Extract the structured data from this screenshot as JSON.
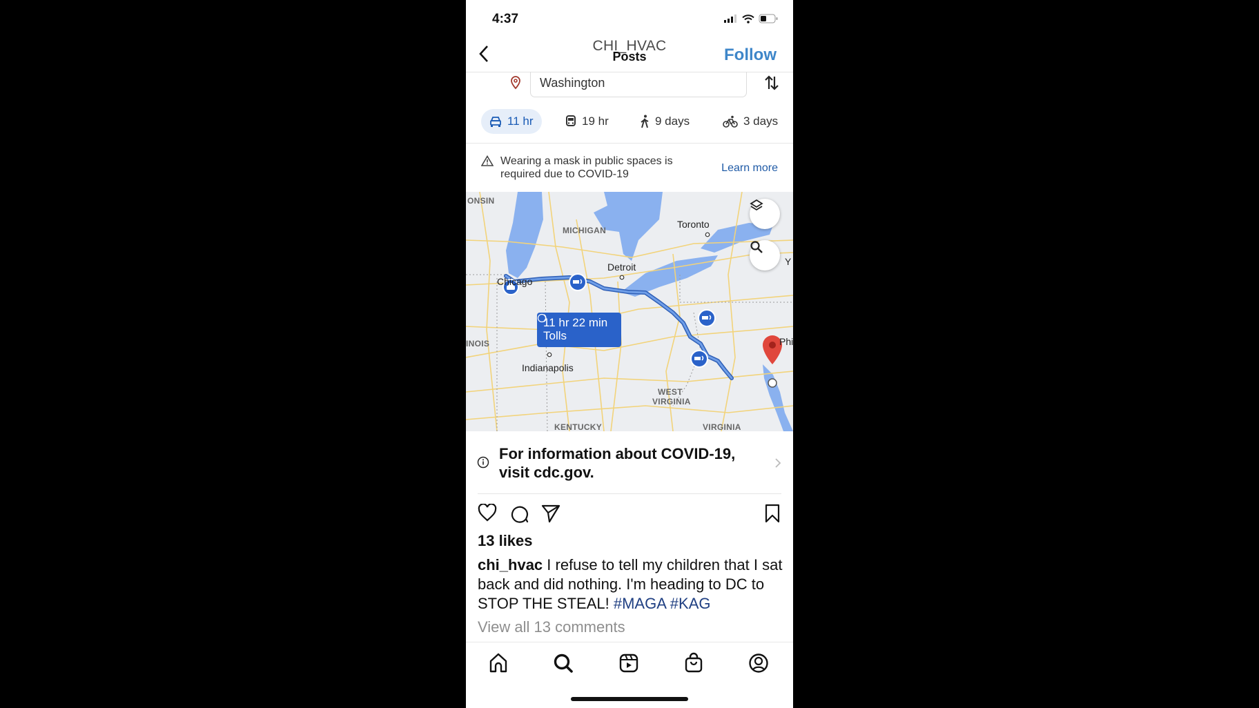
{
  "status_bar": {
    "time": "4:37",
    "icons": [
      "signal-icon",
      "wifi-icon",
      "battery-icon"
    ]
  },
  "header": {
    "username": "CHI_HVAC",
    "subtitle": "Posts",
    "follow_label": "Follow",
    "back_icon": "chevron-left-icon"
  },
  "maps": {
    "destination": "Washington",
    "modes": [
      {
        "icon": "car-icon",
        "label": "11 hr",
        "active": true
      },
      {
        "icon": "transit-icon",
        "label": "19 hr",
        "active": false
      },
      {
        "icon": "walk-icon",
        "label": "9 days",
        "active": false
      },
      {
        "icon": "bike-icon",
        "label": "3 days",
        "active": false
      }
    ],
    "notice": {
      "text": "Wearing a mask in public spaces is required due to COVID-19",
      "link": "Learn more"
    },
    "map": {
      "region_labels": [
        "ONSIN",
        "MICHIGAN",
        "INOIS",
        "WEST",
        "VIRGINIA",
        "KENTUCKY",
        "VIRGINIA"
      ],
      "cities": [
        "Toronto",
        "Detroit",
        "Chicago",
        "Indianapolis",
        "Phi",
        "Y"
      ],
      "route_time": "11 hr 22 min",
      "route_note": "Tolls",
      "colors": {
        "route": "#4a7fd6",
        "water": "#8ab1ef",
        "roads": "#f2d37a",
        "pin": "#e0473c",
        "label_box": "#2a62c9"
      }
    }
  },
  "post": {
    "info_banner": "For information about COVID-19, visit cdc.gov.",
    "likes": "13 likes",
    "author": "chi_hvac",
    "caption": " I refuse to tell my children that I sat back and did nothing. I'm heading to DC to STOP THE STEAL!  ",
    "hashtags": [
      "#MAGA",
      "#KAG"
    ],
    "view_comments": "View all 13 comments"
  },
  "tabbar": [
    "home-icon",
    "search-icon",
    "reels-icon",
    "shop-icon",
    "profile-icon"
  ]
}
